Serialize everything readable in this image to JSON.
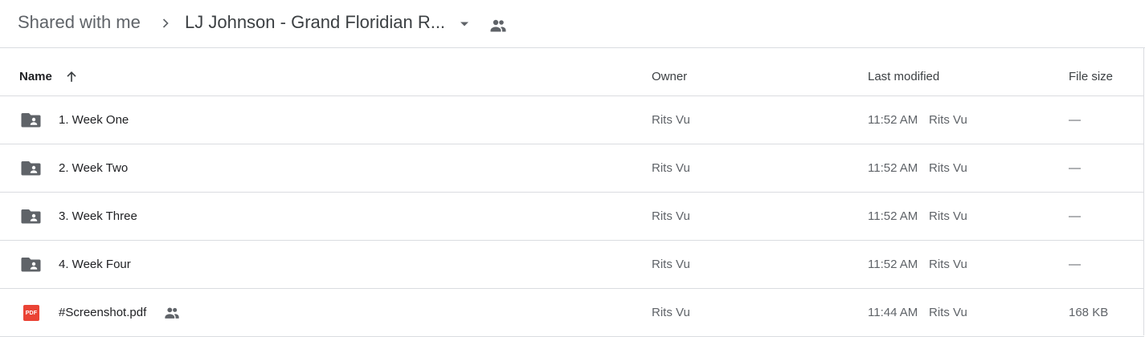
{
  "breadcrumb": {
    "root": "Shared with me",
    "current": "LJ Johnson - Grand Floridian R...",
    "separator_icon": "chevron-right-icon",
    "dropdown_icon": "caret-down-icon",
    "shared_icon": "people-icon"
  },
  "table": {
    "columns": {
      "name": "Name",
      "owner": "Owner",
      "last_modified": "Last modified",
      "file_size": "File size"
    },
    "sort_icon": "arrow-up-icon",
    "rows": [
      {
        "name": "1. Week One",
        "type": "shared-folder",
        "owner": "Rits Vu",
        "modified_time": "11:52 AM",
        "modified_by": "Rits Vu",
        "size": "—"
      },
      {
        "name": "2. Week Two",
        "type": "shared-folder",
        "owner": "Rits Vu",
        "modified_time": "11:52 AM",
        "modified_by": "Rits Vu",
        "size": "—"
      },
      {
        "name": "3. Week Three",
        "type": "shared-folder",
        "owner": "Rits Vu",
        "modified_time": "11:52 AM",
        "modified_by": "Rits Vu",
        "size": "—"
      },
      {
        "name": "4. Week Four",
        "type": "shared-folder",
        "owner": "Rits Vu",
        "modified_time": "11:52 AM",
        "modified_by": "Rits Vu",
        "size": "—"
      },
      {
        "name": "#Screenshot.pdf",
        "type": "pdf",
        "badge": "PDF",
        "shared": true,
        "owner": "Rits Vu",
        "modified_time": "11:44 AM",
        "modified_by": "Rits Vu",
        "size": "168 KB"
      }
    ]
  },
  "colors": {
    "text_primary": "#202124",
    "text_secondary": "#5f6368",
    "divider": "#dadce0",
    "folder_icon": "#5f6368",
    "pdf_red": "#ea4335"
  }
}
